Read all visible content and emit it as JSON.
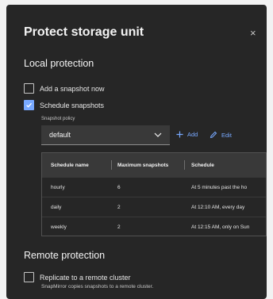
{
  "dialog": {
    "title": "Protect storage unit",
    "close_glyph": "×"
  },
  "local": {
    "heading": "Local protection",
    "add_snapshot_label": "Add a snapshot now",
    "add_snapshot_checked": false,
    "schedule_label": "Schedule snapshots",
    "schedule_checked": true,
    "policy_label": "Snapshot policy",
    "policy_value": "default",
    "add_label": "Add",
    "edit_label": "Edit"
  },
  "table": {
    "headers": [
      "Schedule name",
      "Maximum snapshots",
      "Schedule"
    ],
    "rows": [
      [
        "hourly",
        "6",
        "At 5 minutes past the ho"
      ],
      [
        "daily",
        "2",
        "At 12:10 AM, every day"
      ],
      [
        "weekly",
        "2",
        "At 12:15 AM, only on Sun"
      ]
    ]
  },
  "remote": {
    "heading": "Remote protection",
    "replicate_label": "Replicate to a remote cluster",
    "replicate_checked": false,
    "help_text": "SnapMirror copies snapshots to a remote cluster."
  },
  "icons": {
    "close": "close-icon",
    "checkmark": "checkmark-icon",
    "chevron": "chevron-down-icon",
    "add": "plus-icon",
    "edit": "pencil-icon"
  },
  "colors": {
    "background": "#262626",
    "accent": "#78a9ff",
    "field": "#393939"
  }
}
